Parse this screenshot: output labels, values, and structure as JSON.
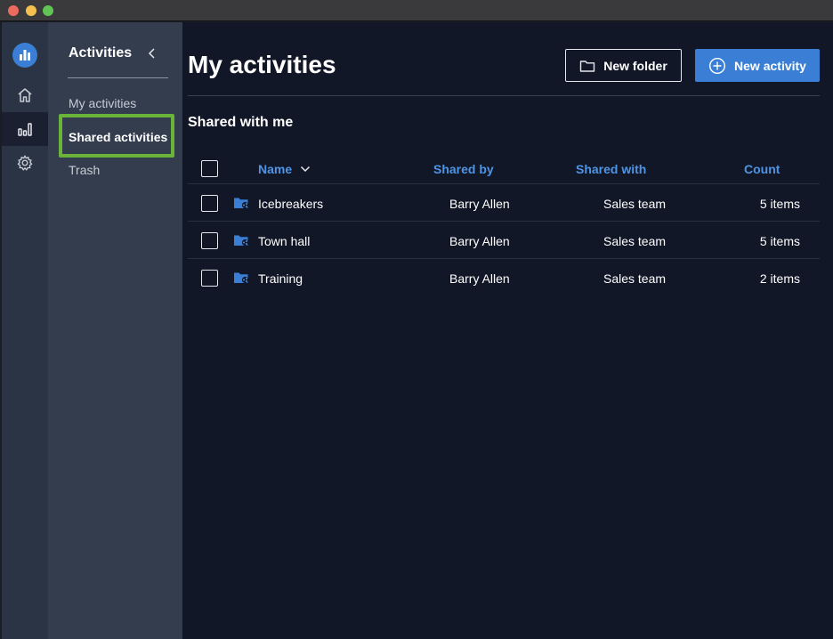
{
  "window": {
    "controls": [
      "close",
      "minimize",
      "zoom"
    ]
  },
  "rail": {
    "items": [
      {
        "icon": "app-logo-icon"
      },
      {
        "icon": "home-icon"
      },
      {
        "icon": "activities-chart-icon",
        "active": true
      },
      {
        "icon": "settings-gear-icon"
      }
    ]
  },
  "subnav": {
    "title": "Activities",
    "items": [
      {
        "label": "My activities"
      },
      {
        "label": "Shared activities",
        "selected": true
      },
      {
        "label": "Trash"
      }
    ]
  },
  "main": {
    "title": "My activities",
    "new_folder_label": "New folder",
    "new_activity_label": "New activity",
    "section_title": "Shared with me"
  },
  "table": {
    "columns": {
      "name": "Name",
      "shared_by": "Shared by",
      "shared_with": "Shared with",
      "count": "Count"
    },
    "rows": [
      {
        "name": "Icebreakers",
        "shared_by": "Barry Allen",
        "shared_with": "Sales team",
        "count": "5 items"
      },
      {
        "name": "Town hall",
        "shared_by": "Barry Allen",
        "shared_with": "Sales team",
        "count": "5 items"
      },
      {
        "name": "Training",
        "shared_by": "Barry Allen",
        "shared_with": "Sales team",
        "count": "2 items"
      }
    ]
  },
  "colors": {
    "accent": "#3a7fd5",
    "column_header": "#4f95e6",
    "highlight": "#6ab43a",
    "main_bg": "#121727",
    "subnav_bg": "#333d4e",
    "rail_bg": "#2b3444"
  }
}
